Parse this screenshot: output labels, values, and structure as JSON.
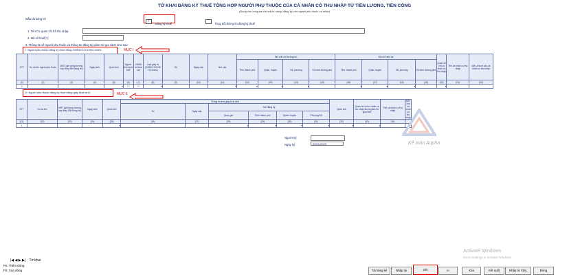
{
  "form": {
    "title": "TỜ KHAI ĐĂNG KÝ THUẾ TỔNG HỢP NGƯỜI PHỤ THUỘC CỦA CÁ NHÂN CÓ THU NHẬP TỪ TIỀN LƯƠNG, TIỀN CÔNG",
    "subtitle": "(Dùng cho cơ quan chi trả thu nhập đăng ký cho người phụ thuộc cá nhân)",
    "mau_label": "Mẫu tải bảng kê",
    "dang_ky_thue": "Đăng ký thuế",
    "thay_doi": "Thay đổi thông tin đăng ký thuế",
    "field1_label": "1. Tên Cơ quan chi trả thu nhập:",
    "field2_label": "2. Mã số thuế(*):",
    "field3_label": "3. Thông tin về người phụ thuộc và thông tin đăng ký giảm trừ gia cảnh như sau:"
  },
  "section1": {
    "label": "I. Người phụ thuộc đăng ký thuế bằng CMND/CCCD/Hộ chiếu:",
    "annotation": "MỤC I",
    "group_headers": {
      "dia_chi_noi_thuong_tru": "Địa chỉ nơi thường trú",
      "dia_chi_hien_tai": "Địa chỉ hiện tại"
    },
    "headers": [
      "STT",
      "Họ và tên người phụ thuộc",
      "MST (ghi trong trường hợp thay đổi thông tin)",
      "Ngày sinh",
      "Quốc tịch",
      "Người lớn/ dưới tuổi",
      "CMND số khai sai",
      "Loại giấy tờ (CMND/ CCCD/ Hộ chiếu)",
      "Số",
      "Ngày cấp",
      "Nơi cấp",
      "Tỉnh, thành phố",
      "Quận, huyện",
      "Xã, phường",
      "Số nhà/ đường phố",
      "Tỉnh, thành phố",
      "Quận, huyện",
      "Xã, phường",
      "Số nhà/ đường phố",
      "Quan hệ với cá nhân có thu nhập",
      "Tên cá nhân có thu nhập",
      "Mã số thuế của cá nhân có thu nhập"
    ],
    "indexes": [
      "(1)",
      "(2)",
      "(3)",
      "(4)",
      "(5)",
      "(6)",
      "(7)",
      "(8)",
      "(9)",
      "(10)",
      "(11)",
      "(12)",
      "(13)",
      "(14)",
      "(15)",
      "(16)",
      "(17)",
      "(18)",
      "(19)",
      "(20)",
      "(21)",
      "(22)"
    ],
    "row1_stt": "1"
  },
  "section2": {
    "label": "II. Người phụ thuộc đăng ký thuế bằng giấy khai sinh:",
    "annotation": "MỤC II",
    "group_headers": {
      "thong_tin_giay_khai_sinh": "Thông tin trên giấy khai sinh",
      "noi_dang_ky": "Nơi đăng ký"
    },
    "headers": [
      "STT",
      "Họ và tên",
      "MST (ghi trong trường hợp thay đổi thông tin)",
      "Ngày sinh",
      "Quốc tịch",
      "Số",
      "Ngày cấp",
      "Quốc gia",
      "Tỉnh/ thành phố",
      "Quận/ Huyện",
      "Phường/Xã",
      "Quốc tịch",
      "Quan hệ với cá nhân có thu nhập được giảm trừ gia cảnh",
      "Tên cá nhân có thu nhập",
      "MST của cá nhân có thu nhập"
    ],
    "indexes": [
      "(21)",
      "(22)",
      "(23)",
      "(24)",
      "(25)",
      "(26)",
      "(27)",
      "(28)",
      "(29)",
      "(30)",
      "(31)",
      "(32)",
      "(33)",
      "(34)"
    ],
    "row1_stt": "1"
  },
  "sign": {
    "nguoi_ky_label": "Người ký:",
    "ngay_ky_label": "Ngày ký:",
    "ngay_ky_value": "02/01/2023"
  },
  "footer": {
    "sheet_tab": "Tờ khai",
    "nav_arrows": "|◀ ◀ ▶ ▶|",
    "hint1": "F5: Thêm dòng",
    "hint2": "F6: Xóa dòng",
    "activate_title": "Activate Windows",
    "activate_sub": "Go to Settings to activate Windows.",
    "buttons": [
      "Tải bảng kê",
      "Nhập lại",
      "Ghi",
      "In",
      "Xóa",
      "Kết xuất",
      "Nhập từ XML",
      "Đóng"
    ]
  },
  "watermark": {
    "text": "Kế toán Anpha"
  },
  "colors": {
    "accent_red": "#e00000",
    "header_text": "#1a2a6c",
    "header_bg": "#e6ecf7"
  }
}
